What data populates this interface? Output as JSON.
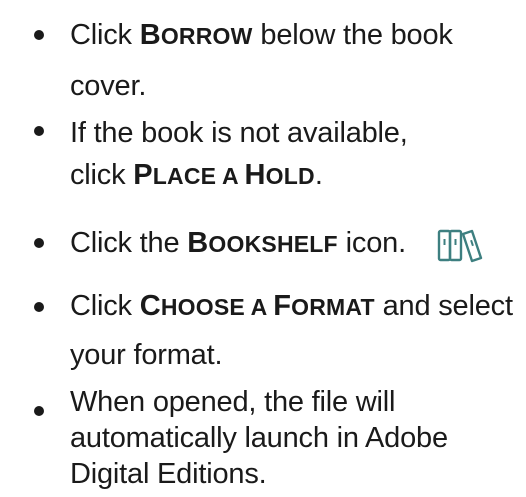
{
  "steps": [
    {
      "before": "Click ",
      "keyword_first": "B",
      "keyword_rest": "ORROW",
      "after_line1": " below the book",
      "line2": "cover."
    },
    {
      "line1": "If the book is not available,",
      "before": "click ",
      "keyword1_first": "P",
      "keyword1_rest": "LACE A ",
      "keyword2_first": "H",
      "keyword2_rest": "OLD",
      "after": "."
    },
    {
      "before": "Click the ",
      "keyword_first": "B",
      "keyword_rest": "OOKSHELF",
      "after": " icon.",
      "icon": "bookshelf-icon"
    },
    {
      "before": "Click ",
      "keyword1_first": "C",
      "keyword1_rest": "HOOSE A ",
      "keyword2_first": "F",
      "keyword2_rest": "ORMAT",
      "after_line1": " and select",
      "line2": "your format."
    },
    {
      "line1": "When opened, the file will",
      "line2": "automatically launch in Adobe",
      "line3": "Digital Editions."
    }
  ],
  "colors": {
    "text": "#1a1a1a",
    "icon": "#3d7f80"
  }
}
